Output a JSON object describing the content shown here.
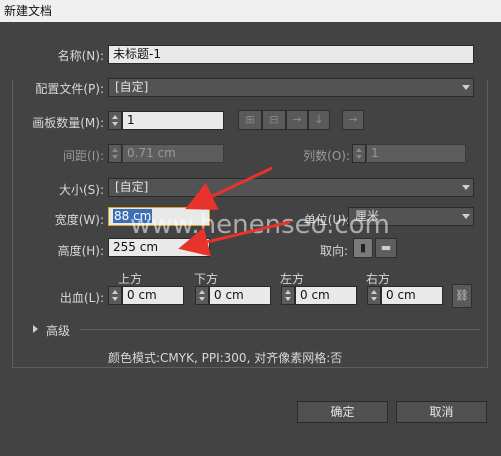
{
  "window": {
    "title": "新建文档"
  },
  "name": {
    "label": "名称(N):",
    "value": "未标题-1"
  },
  "profile": {
    "label": "配置文件(P):",
    "value": "[自定]"
  },
  "artboards": {
    "label": "画板数量(M):",
    "value": "1"
  },
  "spacing": {
    "label": "间距(I):",
    "value": "0.71 cm"
  },
  "columns": {
    "label": "列数(O):",
    "value": "1"
  },
  "size": {
    "label": "大小(S):",
    "value": "[自定]"
  },
  "width": {
    "label": "宽度(W):",
    "value": "88 cm"
  },
  "units": {
    "label": "单位(U):",
    "value": "厘米"
  },
  "height": {
    "label": "高度(H):",
    "value": "255 cm"
  },
  "orientation": {
    "label": "取向:"
  },
  "bleed": {
    "label": "出血(L):",
    "top": {
      "label": "上方",
      "value": "0 cm"
    },
    "bottom": {
      "label": "下方",
      "value": "0 cm"
    },
    "left": {
      "label": "左方",
      "value": "0 cm"
    },
    "right": {
      "label": "右方",
      "value": "0 cm"
    }
  },
  "advanced": {
    "label": "高级"
  },
  "info": {
    "text": "颜色模式:CMYK, PPI:300, 对齐像素网格:否"
  },
  "buttons": {
    "ok": "确定",
    "cancel": "取消"
  },
  "watermark": "www.henenseo.com",
  "colors": {
    "background": "#434343",
    "selection": "#3b6fb6",
    "annotation_arrow": "#e8322c"
  }
}
